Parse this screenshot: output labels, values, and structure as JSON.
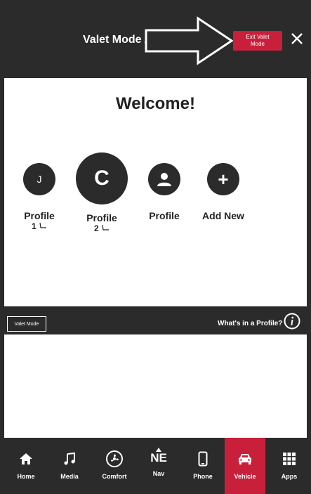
{
  "header": {
    "title": "Valet Mode Ac",
    "exit_button_label_line1": "Exit Valet",
    "exit_button_label_line2": "Mode"
  },
  "welcome": "Welcome!",
  "profiles": [
    {
      "initial": "J",
      "label": "Profile",
      "sub": "1"
    },
    {
      "initial": "C",
      "label": "Profile",
      "sub": "2"
    },
    {
      "initial": "",
      "label": "Profile",
      "sub": ""
    },
    {
      "initial": "+",
      "label": "Add New",
      "sub": ""
    }
  ],
  "midbar": {
    "valet_mode_label": "Valet Mode",
    "whats_in_profile": "What's in a Profile?"
  },
  "nav": {
    "items": [
      {
        "label": "Home",
        "icon": "home-icon"
      },
      {
        "label": "Media",
        "icon": "music-note-icon"
      },
      {
        "label": "Comfort",
        "icon": "fan-icon"
      },
      {
        "label": "Nav",
        "icon": "compass-ne-icon",
        "glyph": "NE"
      },
      {
        "label": "Phone",
        "icon": "phone-icon"
      },
      {
        "label": "Vehicle",
        "icon": "car-icon"
      },
      {
        "label": "Apps",
        "icon": "grid-icon"
      }
    ],
    "active": "Vehicle"
  },
  "colors": {
    "dark": "#2b2b2b",
    "accent": "#c8203a",
    "white": "#ffffff"
  }
}
